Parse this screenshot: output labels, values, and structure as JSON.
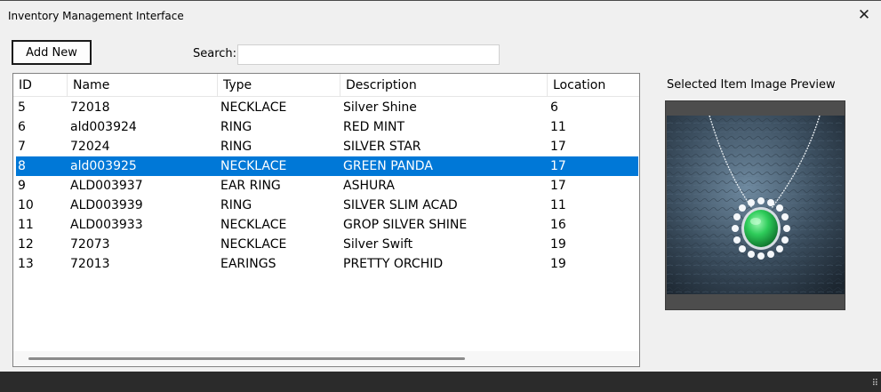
{
  "window": {
    "title": "Inventory Management Interface",
    "close_glyph": "✕"
  },
  "toolbar": {
    "add_label": "Add New",
    "search_label": "Search:",
    "search_value": ""
  },
  "table": {
    "columns": [
      "ID",
      "Name",
      "Type",
      "Description",
      "Location"
    ],
    "selected_row_index": 3,
    "rows": [
      [
        "5",
        "72018",
        "NECKLACE",
        "Silver Shine",
        "6"
      ],
      [
        "6",
        "ald003924",
        "RING",
        "RED MINT",
        "11"
      ],
      [
        "7",
        "72024",
        "RING",
        "SILVER STAR",
        "17"
      ],
      [
        "8",
        "ald003925",
        "NECKLACE",
        "GREEN PANDA",
        "17"
      ],
      [
        "9",
        "ALD003937",
        "EAR RING",
        "ASHURA",
        "17"
      ],
      [
        "10",
        "ALD003939",
        "RING",
        "SILVER SLIM ACAD",
        "11"
      ],
      [
        "11",
        "ALD003933",
        "NECKLACE",
        "GROP SILVER SHINE",
        "16"
      ],
      [
        "12",
        "72073",
        "NECKLACE",
        "Silver Swift",
        "19"
      ],
      [
        "13",
        "72013",
        "EARINGS",
        "PRETTY ORCHID",
        "19"
      ]
    ]
  },
  "preview": {
    "label": "Selected Item Image Preview",
    "image": "green-gem-necklace-photo"
  },
  "colors": {
    "selection": "#0078d7",
    "gem": "#2ecc5a"
  }
}
